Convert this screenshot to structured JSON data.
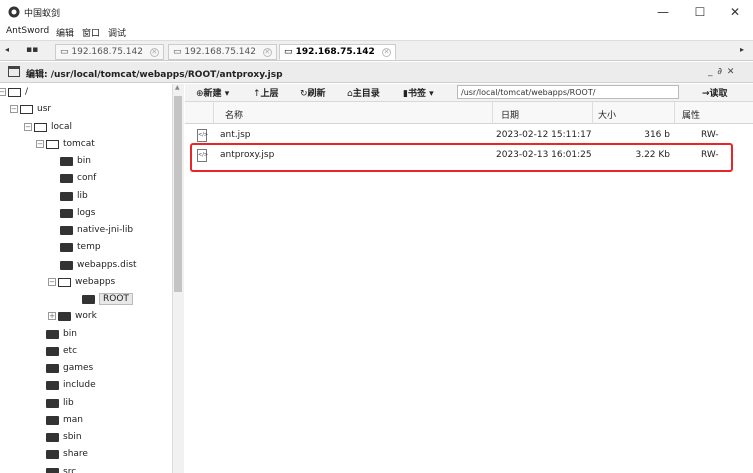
{
  "window": {
    "title": "中国蚁剑",
    "controls": {
      "minimize": "—",
      "maximize": "☐",
      "close": "✕"
    }
  },
  "menu": [
    "AntSword",
    "编辑",
    "窗口",
    "调试"
  ],
  "tabs": {
    "grid_icon": "grid-icon",
    "items": [
      {
        "label": "192.168.75.142",
        "active": false
      },
      {
        "label": "192.168.75.142",
        "active": false
      },
      {
        "label": "192.168.75.142",
        "active": true
      }
    ]
  },
  "panel": {
    "title": "编辑: /usr/local/tomcat/webapps/ROOT/antproxy.jsp",
    "controls": "_ ∂ ✕"
  },
  "toolbar": {
    "new": "新建",
    "up": "上层",
    "refresh": "刷新",
    "home": "主目录",
    "bookmark": "书签",
    "path_value": "/usr/local/tomcat/webapps/ROOT/",
    "read": "读取"
  },
  "tree": [
    {
      "label": "/",
      "icon": "open",
      "exp": "⊟"
    },
    {
      "label": "usr",
      "icon": "open",
      "exp": "⊟"
    },
    {
      "label": "local",
      "icon": "open",
      "exp": "⊟"
    },
    {
      "label": "tomcat",
      "icon": "open",
      "exp": "⊟"
    },
    {
      "label": "bin",
      "icon": "closed"
    },
    {
      "label": "conf",
      "icon": "closed"
    },
    {
      "label": "lib",
      "icon": "closed"
    },
    {
      "label": "logs",
      "icon": "closed"
    },
    {
      "label": "native-jni-lib",
      "icon": "closed"
    },
    {
      "label": "temp",
      "icon": "closed"
    },
    {
      "label": "webapps.dist",
      "icon": "closed"
    },
    {
      "label": "webapps",
      "icon": "open",
      "exp": "⊟"
    },
    {
      "label": "ROOT",
      "icon": "closed",
      "selected": true
    },
    {
      "label": "work",
      "icon": "closed",
      "exp": "⊞"
    },
    {
      "label": "bin",
      "icon": "closed"
    },
    {
      "label": "etc",
      "icon": "closed"
    },
    {
      "label": "games",
      "icon": "closed"
    },
    {
      "label": "include",
      "icon": "closed"
    },
    {
      "label": "lib",
      "icon": "closed"
    },
    {
      "label": "man",
      "icon": "closed"
    },
    {
      "label": "sbin",
      "icon": "closed"
    },
    {
      "label": "share",
      "icon": "closed"
    },
    {
      "label": "src",
      "icon": "closed"
    }
  ],
  "grid": {
    "headers": {
      "name": "名称",
      "date": "日期",
      "size": "大小",
      "attr": "属性"
    },
    "rows": [
      {
        "name": "ant.jsp",
        "date": "2023-02-12 15:11:17",
        "size": "316 b",
        "attr": "RW-"
      },
      {
        "name": "antproxy.jsp",
        "date": "2023-02-13 16:01:25",
        "size": "3.22 Kb",
        "attr": "RW-"
      }
    ]
  },
  "colors": {
    "highlight": "#e8262a"
  }
}
